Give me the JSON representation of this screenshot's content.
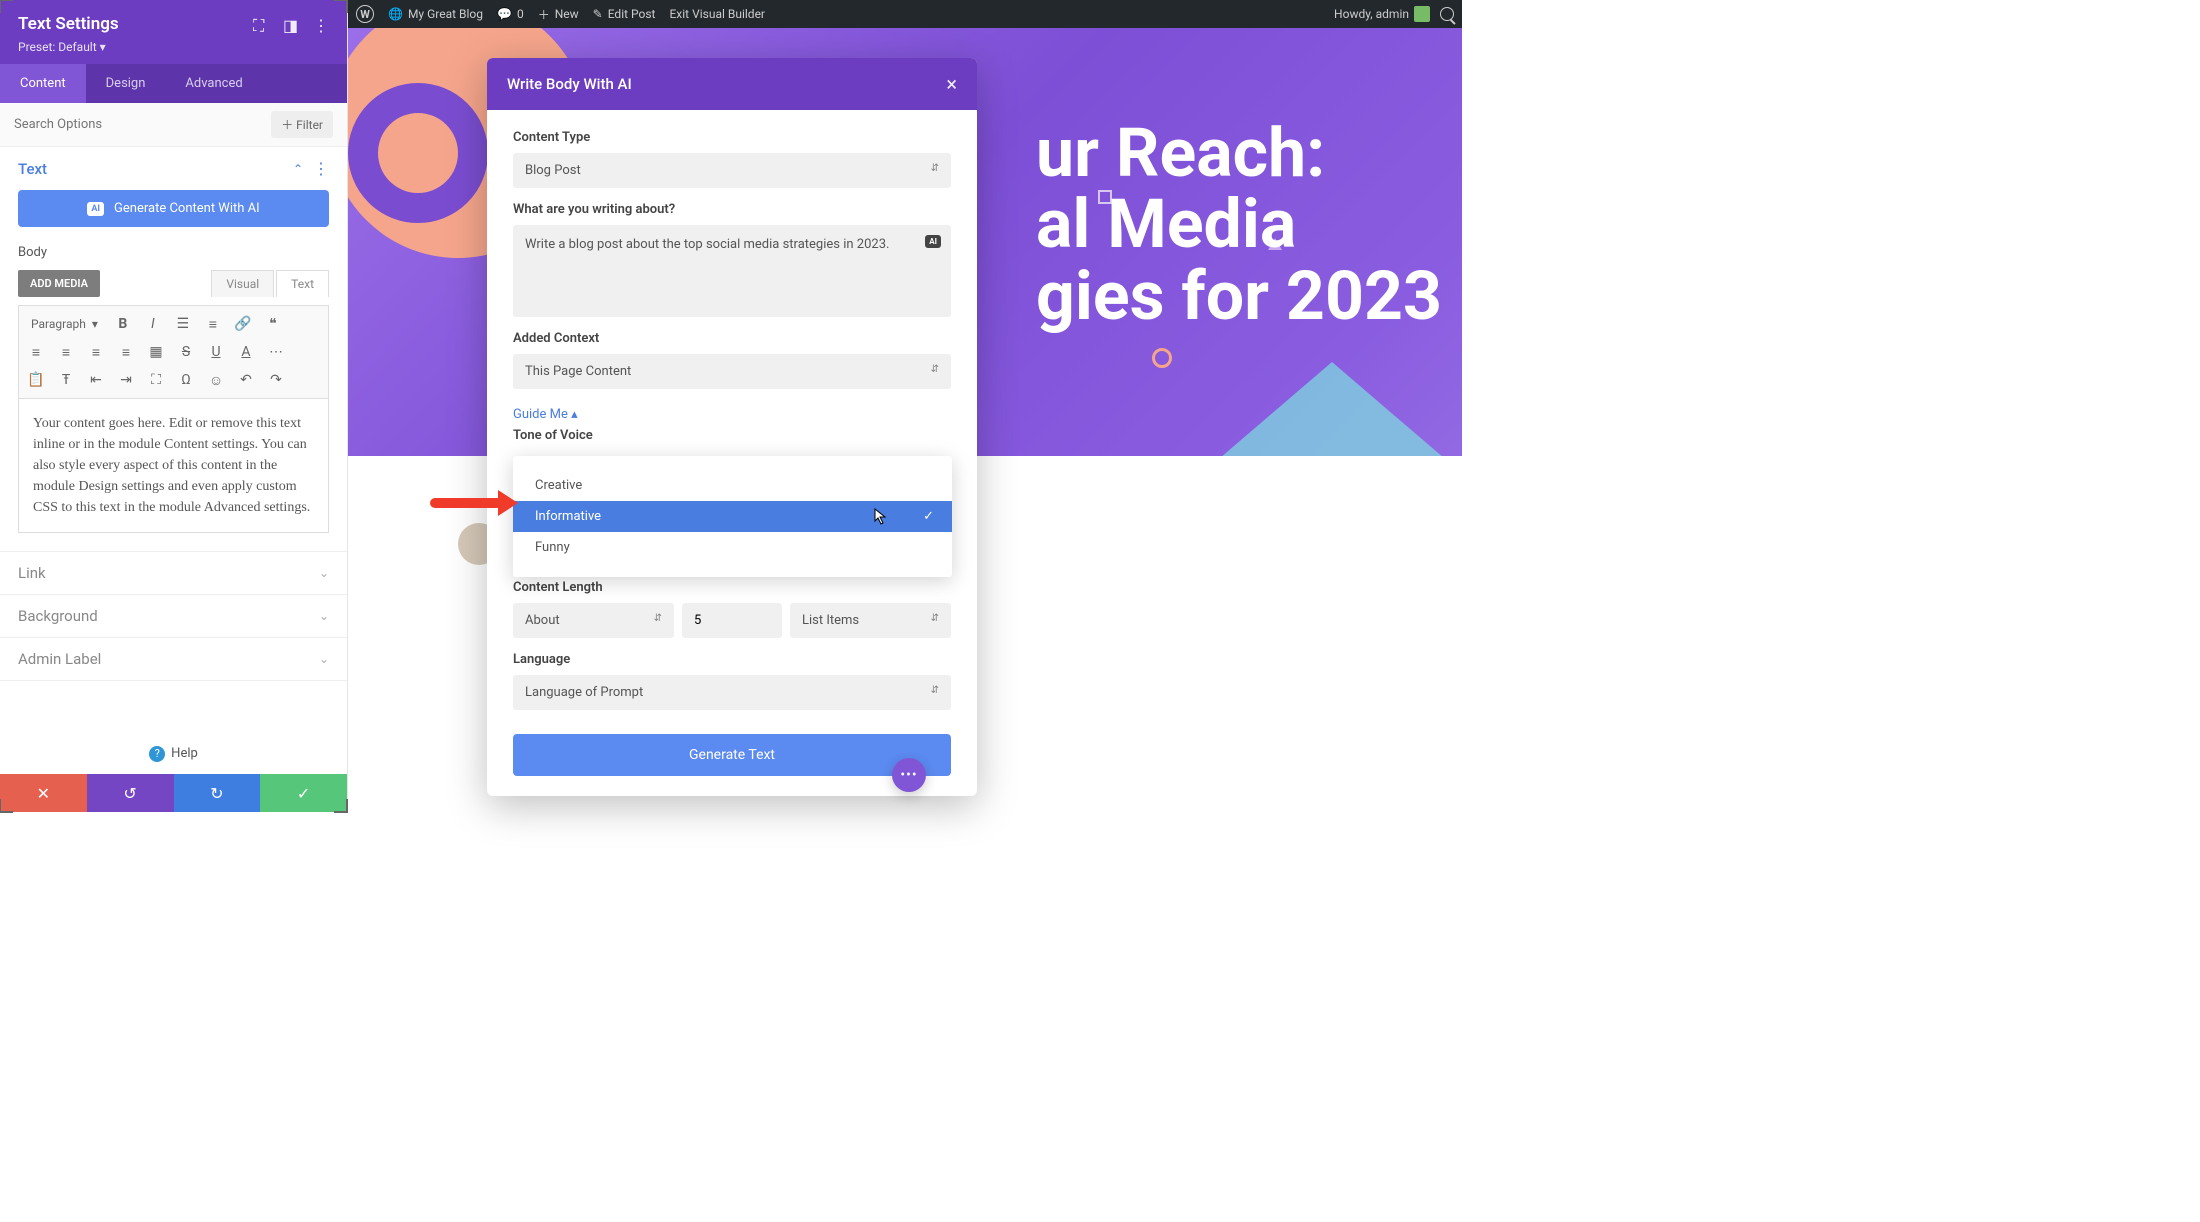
{
  "admin_bar": {
    "site_name": "My Great Blog",
    "comments": "0",
    "new": "New",
    "edit_post": "Edit Post",
    "exit_vb": "Exit Visual Builder",
    "howdy": "Howdy, admin"
  },
  "sidebar": {
    "title": "Text Settings",
    "preset": "Preset: Default ▾",
    "tabs": {
      "content": "Content",
      "design": "Design",
      "advanced": "Advanced"
    },
    "search_placeholder": "Search Options",
    "filter": "Filter",
    "sections": {
      "text": {
        "label": "Text"
      },
      "link": {
        "label": "Link"
      },
      "background": {
        "label": "Background"
      },
      "admin_label": {
        "label": "Admin Label"
      }
    },
    "generate_btn": "Generate Content With AI",
    "body_label": "Body",
    "add_media": "ADD MEDIA",
    "ed_visual": "Visual",
    "ed_text": "Text",
    "paragraph": "Paragraph",
    "editor_text": "Your content goes here. Edit or remove this text inline or in the module Content settings. You can also style every aspect of this content in the module Design settings and even apply custom CSS to this text in the module Advanced settings.",
    "help": "Help"
  },
  "page": {
    "hero_line1": "ur Reach:",
    "hero_line2": "al Media",
    "hero_line3": "gies for 2023"
  },
  "modal": {
    "title": "Write Body With AI",
    "content_type_label": "Content Type",
    "content_type_value": "Blog Post",
    "about_label": "What are you writing about?",
    "about_value": "Write a blog post about the top social media strategies in 2023.",
    "context_label": "Added Context",
    "context_value": "This Page Content",
    "guide_me": "Guide Me  ▴",
    "tone_label": "Tone of Voice",
    "tone_options": {
      "creative": "Creative",
      "informative": "Informative",
      "funny": "Funny"
    },
    "content_length_label": "Content Length",
    "length_about": "About",
    "length_value": "5",
    "length_unit": "List Items",
    "language_label": "Language",
    "language_value": "Language of Prompt",
    "generate": "Generate Text"
  }
}
